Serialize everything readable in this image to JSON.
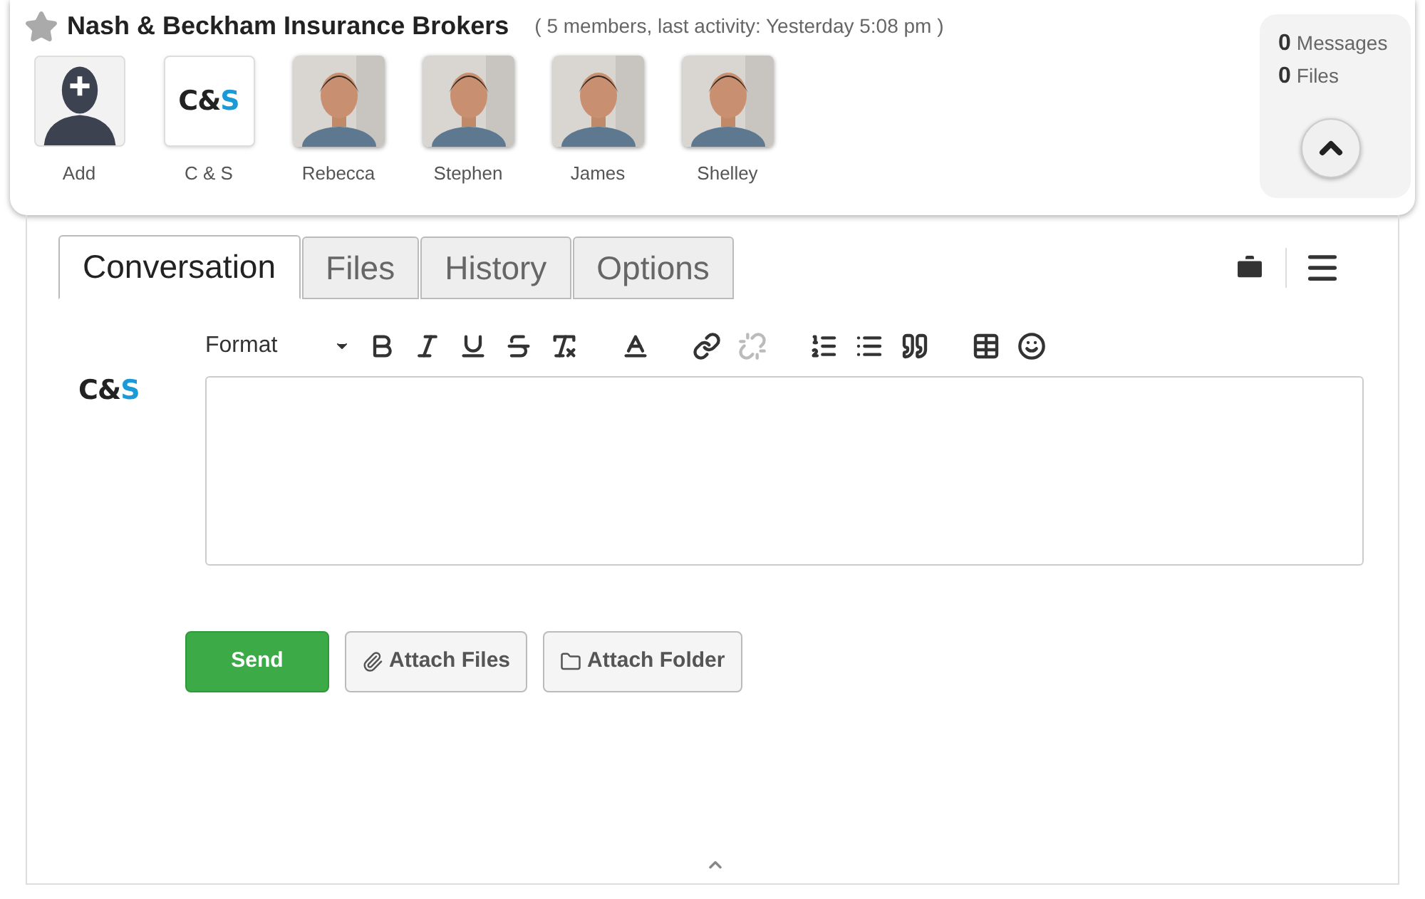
{
  "group": {
    "starred": false,
    "title": "Nash & Beckham Insurance Brokers",
    "meta": "( 5 members, last activity: Yesterday 5:08 pm )"
  },
  "members": [
    {
      "kind": "add",
      "name": "Add"
    },
    {
      "kind": "logo",
      "name": "C & S",
      "logo": {
        "dark": "C&",
        "accent": "S"
      }
    },
    {
      "name": "Rebecca"
    },
    {
      "name": "Stephen"
    },
    {
      "name": "James"
    },
    {
      "name": "Shelley"
    }
  ],
  "stats": [
    {
      "count": "0",
      "label": "Messages"
    },
    {
      "count": "0",
      "label": "Files"
    }
  ],
  "tabs": [
    {
      "label": "Conversation",
      "selected": true
    },
    {
      "label": "Files",
      "selected": false
    },
    {
      "label": "History",
      "selected": false
    },
    {
      "label": "Options",
      "selected": false
    }
  ],
  "composer": {
    "logo": {
      "dark": "C&",
      "accent": "S"
    },
    "format_label": "Format",
    "tools": [
      {
        "kind": "bold",
        "disabled": false
      },
      {
        "kind": "italic",
        "disabled": false
      },
      {
        "kind": "underline",
        "disabled": false
      },
      {
        "kind": "strike",
        "disabled": false
      },
      {
        "kind": "clear",
        "disabled": false
      },
      {
        "kind": "color",
        "disabled": false
      },
      {
        "kind": "link",
        "disabled": false
      },
      {
        "kind": "unlink",
        "disabled": true
      },
      {
        "kind": "ordered",
        "disabled": false
      },
      {
        "kind": "bullets",
        "disabled": false
      },
      {
        "kind": "quote",
        "disabled": false
      },
      {
        "kind": "table",
        "disabled": false
      },
      {
        "kind": "emoji",
        "disabled": false
      }
    ]
  },
  "buttons": [
    {
      "kind": "send",
      "label": "Send"
    },
    {
      "kind": "files",
      "label": "Attach Files"
    },
    {
      "kind": "folder",
      "label": "Attach Folder"
    }
  ]
}
